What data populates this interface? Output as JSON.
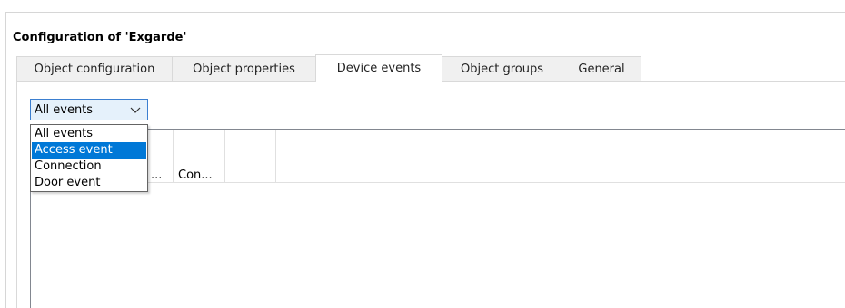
{
  "window": {
    "title": "Configuration of 'Exgarde'"
  },
  "tabs": [
    {
      "label": "Object configuration"
    },
    {
      "label": "Object properties"
    },
    {
      "label": "Device events"
    },
    {
      "label": "Object groups"
    },
    {
      "label": "General"
    }
  ],
  "active_tab": "Device events",
  "filter": {
    "value": "All events",
    "options": [
      "All events",
      "Access event",
      "Connection",
      "Door event"
    ],
    "highlighted": "Access event"
  },
  "grid": {
    "columns": [
      {
        "label": "..."
      },
      {
        "label": "Con..."
      }
    ]
  },
  "colors": {
    "accent": "#0078d7",
    "combo_border": "#3b7fd0",
    "combo_bg": "#e5f1fb"
  }
}
